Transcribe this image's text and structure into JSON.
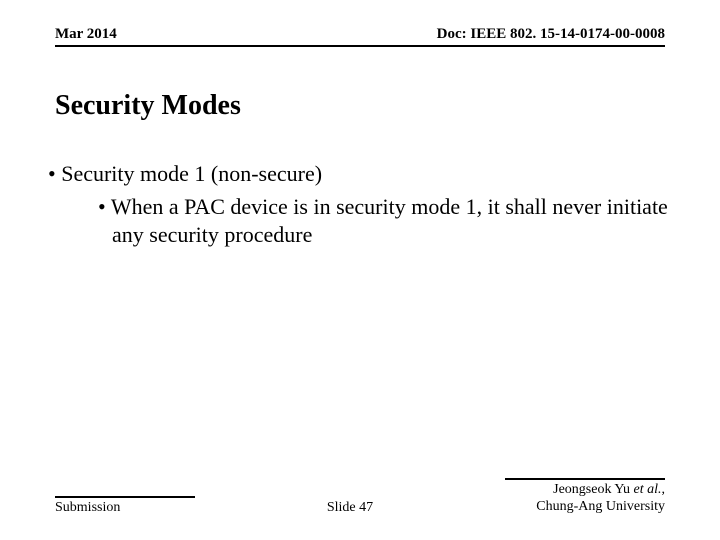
{
  "header": {
    "date": "Mar 2014",
    "doc": "Doc: IEEE 802. 15-14-0174-00-0008"
  },
  "title": "Security Modes",
  "content": {
    "bullet1": "Security mode 1 (non-secure)",
    "bullet2": "When a PAC device is in security mode 1, it shall never initiate any security procedure"
  },
  "footer": {
    "left": "Submission",
    "center": "Slide 47",
    "right_name": "Jeongseok Yu",
    "right_etal": "et al.",
    "right_comma": ", ",
    "right_affil": "Chung-Ang University"
  }
}
